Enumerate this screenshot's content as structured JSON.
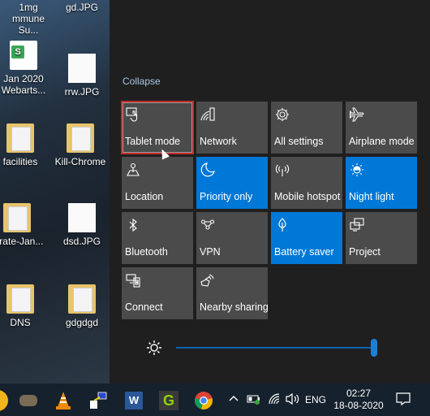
{
  "desktop": {
    "icons": [
      {
        "label": "1mg\nmmune Su...",
        "type": "file"
      },
      {
        "label": "gd.JPG",
        "type": "jpg"
      },
      {
        "label": "Jan 2020\nWebarts...",
        "type": "sheet"
      },
      {
        "label": "rrw.JPG",
        "type": "jpg"
      },
      {
        "label": "facilities",
        "type": "folder"
      },
      {
        "label": "Kill-Chrome",
        "type": "folder"
      },
      {
        "label": "rbrate-Jan...",
        "type": "folder"
      },
      {
        "label": "dsd.JPG",
        "type": "jpg"
      },
      {
        "label": "DNS",
        "type": "folder"
      },
      {
        "label": "gdgdgd",
        "type": "folder"
      }
    ]
  },
  "action_center": {
    "collapse_label": "Collapse",
    "tiles": [
      {
        "label": "Tablet mode",
        "icon": "tablet-mode-icon",
        "active": false,
        "focused": true
      },
      {
        "label": "Network",
        "icon": "network-icon",
        "active": false
      },
      {
        "label": "All settings",
        "icon": "gear-icon",
        "active": false
      },
      {
        "label": "Airplane mode",
        "icon": "airplane-icon",
        "active": false
      },
      {
        "label": "Location",
        "icon": "location-icon",
        "active": false
      },
      {
        "label": "Priority only",
        "icon": "moon-icon",
        "active": true
      },
      {
        "label": "Mobile hotspot",
        "icon": "hotspot-icon",
        "active": false
      },
      {
        "label": "Night light",
        "icon": "night-light-icon",
        "active": true
      },
      {
        "label": "Bluetooth",
        "icon": "bluetooth-icon",
        "active": false
      },
      {
        "label": "VPN",
        "icon": "vpn-icon",
        "active": false
      },
      {
        "label": "Battery saver",
        "icon": "leaf-icon",
        "active": true
      },
      {
        "label": "Project",
        "icon": "project-icon",
        "active": false
      },
      {
        "label": "Connect",
        "icon": "connect-icon",
        "active": false
      },
      {
        "label": "Nearby sharing",
        "icon": "nearby-sharing-icon",
        "active": false
      }
    ],
    "brightness": {
      "value_percent": 100,
      "accent": "#0078d7"
    }
  },
  "taskbar": {
    "apps": [
      "chrome-partial",
      "gimp",
      "vlc",
      "network-tool",
      "word",
      "greenshot",
      "chrome"
    ],
    "tray": {
      "language": "ENG",
      "time": "02:27",
      "date": "18-08-2020"
    }
  },
  "colors": {
    "tile": "#4b4b4b",
    "tile_active": "#0078d7",
    "panel": "#1f1f1f",
    "focus": "#c42b2b"
  }
}
